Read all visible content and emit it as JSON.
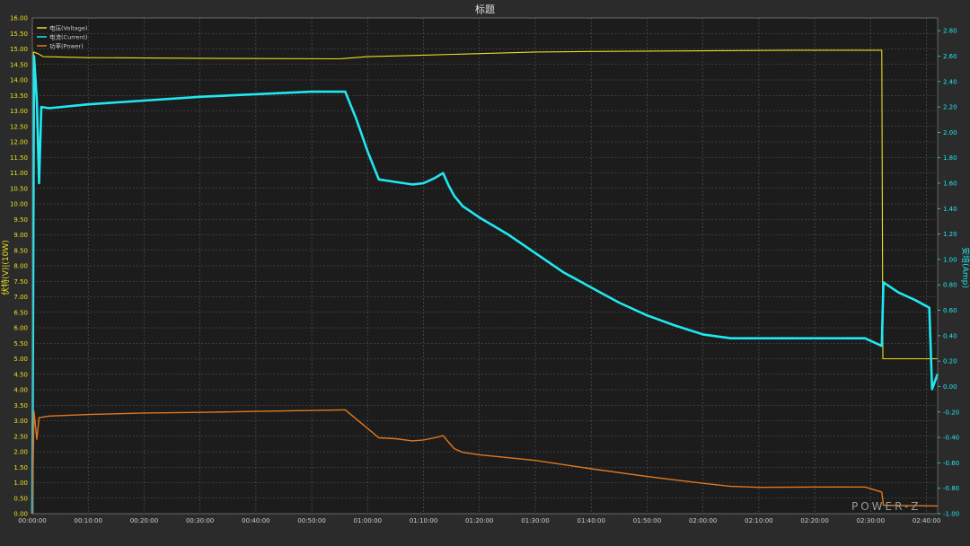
{
  "chart_data": {
    "type": "line",
    "title": "标题",
    "ylabel_left": "伏特(V)|(10W)",
    "ylabel_right": "安培(Amp)",
    "x_ticks": [
      "00:00:00",
      "00:10:00",
      "00:20:00",
      "00:30:00",
      "00:40:00",
      "00:50:00",
      "01:00:00",
      "01:10:00",
      "01:20:00",
      "01:30:00",
      "01:40:00",
      "01:50:00",
      "02:00:00",
      "02:10:00",
      "02:20:00",
      "02:30:00",
      "02:40:00"
    ],
    "x_range_minutes": [
      0,
      162
    ],
    "y_left_range": [
      0,
      16
    ],
    "y_left_ticks": [
      "0.00",
      "0.50",
      "1.00",
      "1.50",
      "2.00",
      "2.50",
      "3.00",
      "3.50",
      "4.00",
      "4.50",
      "5.00",
      "5.50",
      "6.00",
      "6.50",
      "7.00",
      "7.50",
      "8.00",
      "8.50",
      "9.00",
      "9.50",
      "10.00",
      "10.50",
      "11.00",
      "11.50",
      "12.00",
      "12.50",
      "13.00",
      "13.50",
      "14.00",
      "14.50",
      "15.00",
      "15.50",
      "16.00"
    ],
    "y_right_range": [
      -1.0,
      2.9
    ],
    "y_right_ticks": [
      "-1.00",
      "-0.80",
      "-0.60",
      "-0.40",
      "-0.20",
      "0.00",
      "0.20",
      "0.40",
      "0.60",
      "0.80",
      "1.00",
      "1.20",
      "1.40",
      "1.60",
      "1.80",
      "2.00",
      "2.20",
      "2.40",
      "2.60",
      "2.80"
    ],
    "grid": true,
    "legend_position": "top-left",
    "series": [
      {
        "name": "电压(Voltage)",
        "axis": "left",
        "color": "#e8e020",
        "points": [
          [
            0,
            0
          ],
          [
            0.2,
            14.9
          ],
          [
            1,
            14.85
          ],
          [
            2,
            14.75
          ],
          [
            10,
            14.72
          ],
          [
            30,
            14.7
          ],
          [
            55,
            14.68
          ],
          [
            60,
            14.75
          ],
          [
            70,
            14.8
          ],
          [
            80,
            14.85
          ],
          [
            90,
            14.9
          ],
          [
            100,
            14.92
          ],
          [
            110,
            14.93
          ],
          [
            120,
            14.94
          ],
          [
            130,
            14.95
          ],
          [
            140,
            14.96
          ],
          [
            152,
            14.96
          ],
          [
            152.2,
            5.0
          ],
          [
            162,
            5.0
          ]
        ]
      },
      {
        "name": "电流(Current)",
        "axis": "right",
        "color": "#20e8f0",
        "points": [
          [
            0,
            -1.0
          ],
          [
            0.3,
            2.6
          ],
          [
            0.8,
            2.25
          ],
          [
            1.2,
            1.6
          ],
          [
            1.6,
            2.2
          ],
          [
            3,
            2.19
          ],
          [
            10,
            2.22
          ],
          [
            20,
            2.25
          ],
          [
            30,
            2.28
          ],
          [
            40,
            2.3
          ],
          [
            50,
            2.32
          ],
          [
            56,
            2.32
          ],
          [
            58,
            2.1
          ],
          [
            60,
            1.85
          ],
          [
            62,
            1.63
          ],
          [
            65,
            1.61
          ],
          [
            68,
            1.59
          ],
          [
            70,
            1.6
          ],
          [
            72,
            1.64
          ],
          [
            73.5,
            1.68
          ],
          [
            74.5,
            1.58
          ],
          [
            75.5,
            1.5
          ],
          [
            77,
            1.42
          ],
          [
            80,
            1.33
          ],
          [
            85,
            1.2
          ],
          [
            90,
            1.05
          ],
          [
            95,
            0.9
          ],
          [
            100,
            0.78
          ],
          [
            105,
            0.66
          ],
          [
            110,
            0.56
          ],
          [
            115,
            0.48
          ],
          [
            120,
            0.41
          ],
          [
            125,
            0.38
          ],
          [
            130,
            0.38
          ],
          [
            140,
            0.38
          ],
          [
            149,
            0.38
          ],
          [
            152,
            0.32
          ],
          [
            152.3,
            0.82
          ],
          [
            155,
            0.74
          ],
          [
            158,
            0.68
          ],
          [
            160.5,
            0.62
          ],
          [
            161,
            -0.02
          ],
          [
            162,
            0.1
          ]
        ]
      },
      {
        "name": "功率(Power)",
        "axis": "left",
        "color": "#e07820",
        "points": [
          [
            0,
            0
          ],
          [
            0.3,
            3.3
          ],
          [
            0.8,
            2.4
          ],
          [
            1.2,
            3.1
          ],
          [
            3,
            3.15
          ],
          [
            10,
            3.2
          ],
          [
            20,
            3.25
          ],
          [
            30,
            3.27
          ],
          [
            40,
            3.3
          ],
          [
            50,
            3.33
          ],
          [
            56,
            3.35
          ],
          [
            58,
            3.05
          ],
          [
            60,
            2.75
          ],
          [
            62,
            2.45
          ],
          [
            65,
            2.42
          ],
          [
            68,
            2.35
          ],
          [
            70,
            2.38
          ],
          [
            72,
            2.45
          ],
          [
            73.5,
            2.52
          ],
          [
            74.5,
            2.3
          ],
          [
            75.5,
            2.1
          ],
          [
            77,
            1.98
          ],
          [
            80,
            1.9
          ],
          [
            90,
            1.72
          ],
          [
            100,
            1.45
          ],
          [
            110,
            1.2
          ],
          [
            120,
            0.98
          ],
          [
            125,
            0.88
          ],
          [
            130,
            0.85
          ],
          [
            140,
            0.86
          ],
          [
            149,
            0.86
          ],
          [
            152,
            0.7
          ],
          [
            152.3,
            0.27
          ],
          [
            162,
            0.25
          ]
        ]
      }
    ]
  },
  "watermark": "POWER-Z"
}
